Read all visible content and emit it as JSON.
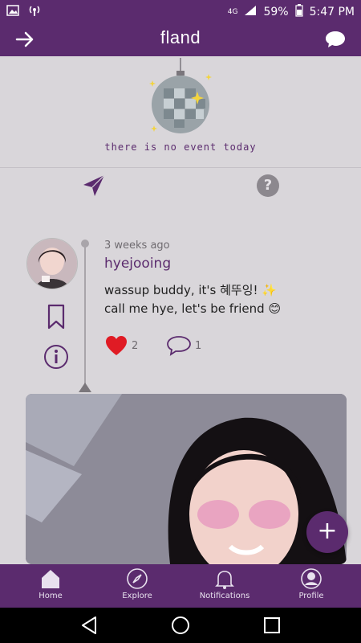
{
  "status_bar": {
    "battery": "59%",
    "time": "5:47 PM",
    "network": "4G"
  },
  "app_bar": {
    "title": "fland",
    "left_icon": "arrow-right-icon",
    "right_icon": "chat-bubble-icon"
  },
  "event": {
    "message": "there is no event today"
  },
  "actions": {
    "send_icon": "paper-plane-icon",
    "help_label": "?"
  },
  "post": {
    "time_ago": "3 weeks ago",
    "username": "hyejooing",
    "body_line1": "wassup buddy, it's 혜뚜잉! ✨",
    "body_line2": "call me hye, let's be friend 😊",
    "like_count": "2",
    "comment_count": "1"
  },
  "fab": {
    "label": "+"
  },
  "bottom_nav": {
    "items": [
      {
        "label": "Home",
        "icon": "home-icon"
      },
      {
        "label": "Explore",
        "icon": "compass-icon"
      },
      {
        "label": "Notifications",
        "icon": "bell-icon"
      },
      {
        "label": "Profile",
        "icon": "user-icon"
      }
    ]
  },
  "colors": {
    "brand": "#5b2b6e",
    "like": "#e01b24"
  }
}
